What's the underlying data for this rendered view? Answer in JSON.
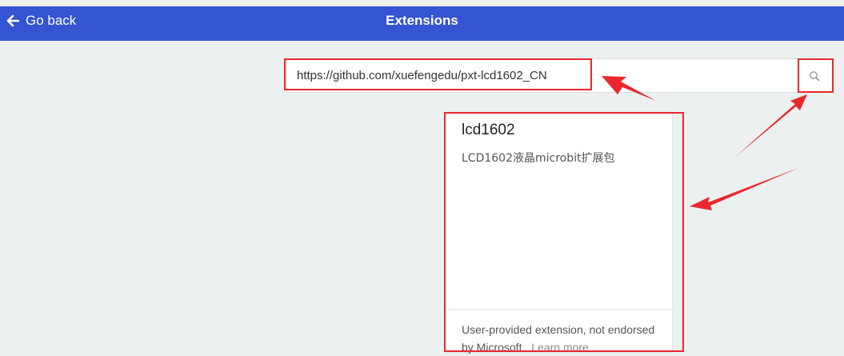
{
  "header": {
    "back_label": "Go back",
    "title": "Extensions",
    "color": "#3454d1"
  },
  "search": {
    "value": "https://github.com/xuefengedu/pxt-lcd1602_CN",
    "button_icon": "search-icon"
  },
  "result_card": {
    "name": "lcd1602",
    "description": "LCD1602液晶microbit扩展包",
    "disclaimer": "User-provided extension, not endorsed by Microsoft.",
    "learn_more": "Learn more"
  },
  "annotation_color": "#e8282c"
}
